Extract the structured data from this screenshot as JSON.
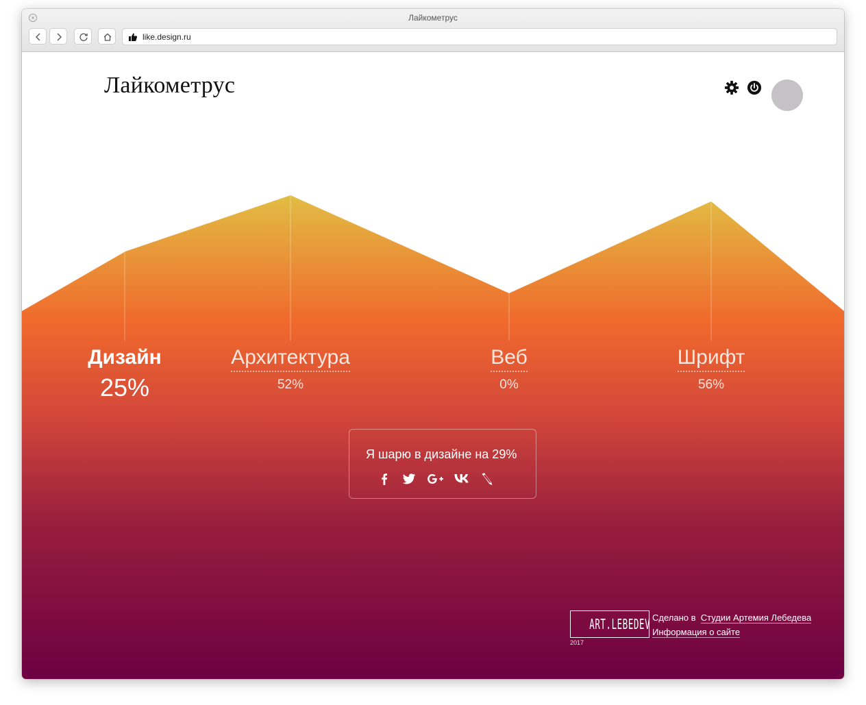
{
  "window": {
    "title": "Лайкометрус"
  },
  "browser": {
    "url": "like.design.ru",
    "buttons": [
      "back",
      "forward",
      "reload",
      "home"
    ]
  },
  "header": {
    "brand": "Лайкометрус",
    "icons": [
      "gear-icon",
      "power-icon"
    ]
  },
  "categories": [
    {
      "id": "design",
      "name": "Дизайн",
      "percent": "25%",
      "active": true
    },
    {
      "id": "architecture",
      "name": "Архитектура",
      "percent": "52%",
      "active": false
    },
    {
      "id": "web",
      "name": "Веб",
      "percent": "0%",
      "active": false
    },
    {
      "id": "font",
      "name": "Шрифт",
      "percent": "56%",
      "active": false
    }
  ],
  "share": {
    "text": "Я шарю в дизайне на 29%",
    "networks": [
      "facebook-icon",
      "twitter-icon",
      "google-plus-icon",
      "vk-icon",
      "livejournal-icon"
    ]
  },
  "footer": {
    "logo": "ART.LEBEDEV",
    "year": "2017",
    "made_by_prefix": "Сделано в",
    "studio_link": "Студии Артемия Лебедева",
    "about_link": "Информация о сайте"
  },
  "colors": {
    "gradient_top": "#e2bd44",
    "gradient_mid": "#f06a2c",
    "gradient_bottom": "#6c0042"
  }
}
